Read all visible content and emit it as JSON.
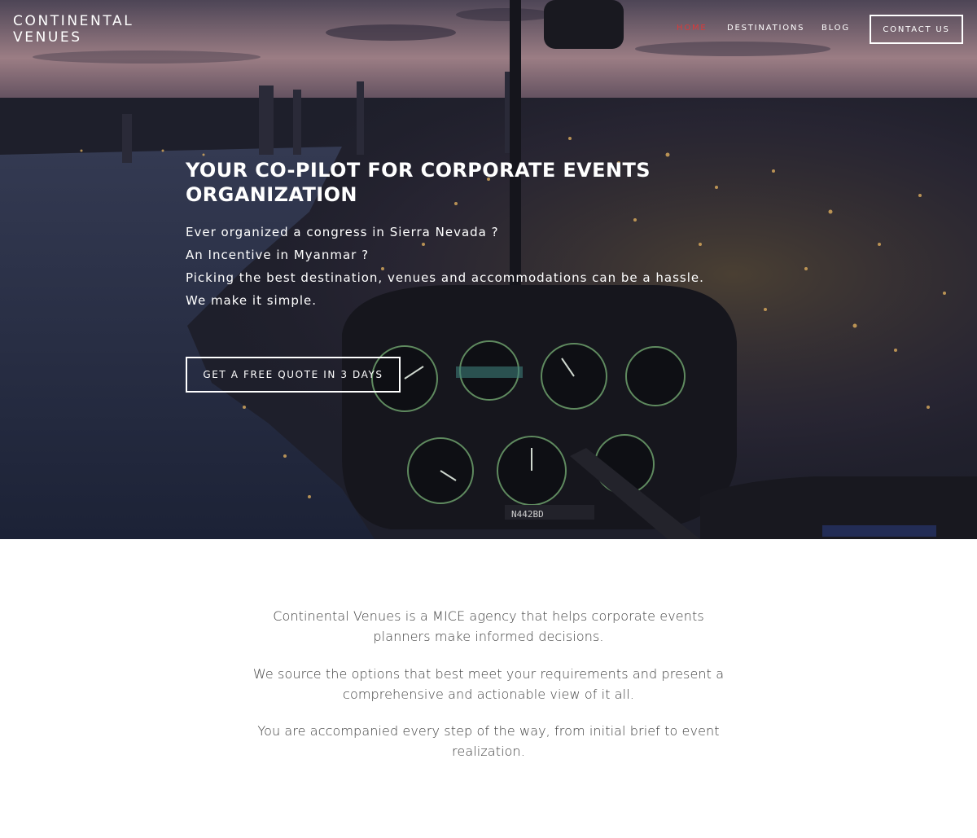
{
  "brand": {
    "line1": "CONTINENTAL",
    "line2": "VENUES"
  },
  "nav": {
    "home": "HOME",
    "destinations": "DESTINATIONS",
    "blog": "BLOG",
    "contact": "CONTACT US"
  },
  "hero": {
    "title_line1": "YOUR CO-PILOT FOR CORPORATE EVENTS",
    "title_line2": "ORGANIZATION",
    "lines": [
      "Ever organized a congress in Sierra Nevada ?",
      "An Incentive in Myanmar ?",
      "Picking the best destination, venues and accommodations can be a hassle.",
      "We make it simple."
    ],
    "cta": "GET A FREE QUOTE IN 3 DAYS",
    "image_text": "N442BD"
  },
  "about": {
    "paragraphs": [
      [
        "Continental Venues is a MICE agency that helps corporate events",
        "planners make informed decisions."
      ],
      [
        "We source the options that best meet your requirements and present a",
        "comprehensive and actionable view of it all."
      ],
      [
        "You are accompanied every step of the way, from initial brief to event",
        "realization."
      ]
    ]
  },
  "colors": {
    "active_nav": "#d83a3a",
    "text_dark": "#3e3e3e",
    "white": "#ffffff"
  }
}
